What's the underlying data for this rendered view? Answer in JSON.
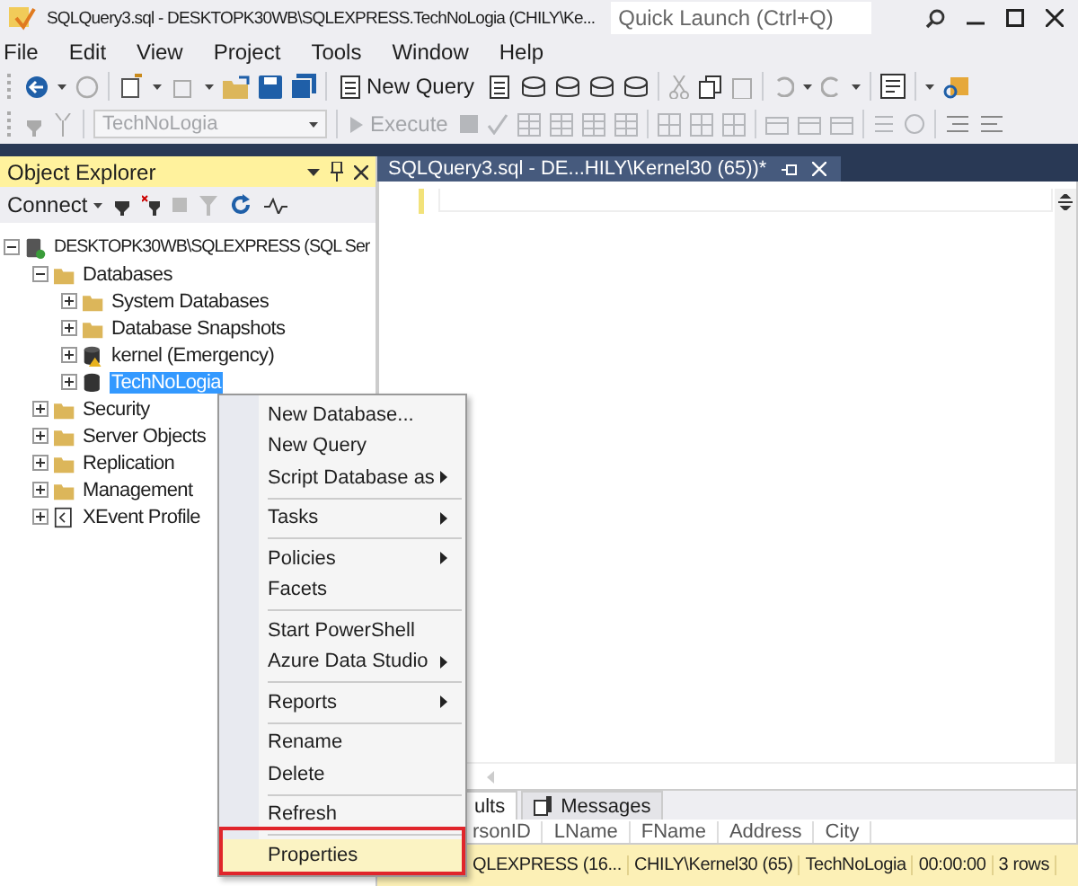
{
  "window": {
    "title": "SQLQuery3.sql - DESKTOPK30WB\\SQLEXPRESS.TechNoLogia (CHILY\\Ke...",
    "quick_launch": {
      "placeholder": "Quick Launch (Ctrl+Q)"
    }
  },
  "menu": [
    "File",
    "Edit",
    "View",
    "Project",
    "Tools",
    "Window",
    "Help"
  ],
  "toolbar": {
    "new_query": "New Query",
    "database": {
      "value": "TechNoLogia",
      "disabled": true
    },
    "execute": {
      "label": "Execute",
      "disabled": true
    }
  },
  "object_explorer": {
    "title": "Object Explorer",
    "active": true,
    "connect": "Connect",
    "tree": [
      {
        "label": "DESKTOPK30WB\\SQLEXPRESS (SQL Ser",
        "kind": "server",
        "expanded": true,
        "selected": false,
        "children": [
          {
            "label": "Databases",
            "kind": "folder",
            "expanded": true,
            "selected": false,
            "children": [
              {
                "label": "System Databases",
                "kind": "folder",
                "expanded": false,
                "selected": false
              },
              {
                "label": "Database Snapshots",
                "kind": "folder",
                "expanded": false,
                "selected": false
              },
              {
                "label": "kernel (Emergency)",
                "kind": "database-warning",
                "expanded": false,
                "selected": false
              },
              {
                "label": "TechNoLogia",
                "kind": "database",
                "expanded": false,
                "selected": true
              }
            ]
          },
          {
            "label": "Security",
            "kind": "folder",
            "expanded": false,
            "selected": false
          },
          {
            "label": "Server Objects",
            "kind": "folder",
            "expanded": false,
            "selected": false
          },
          {
            "label": "Replication",
            "kind": "folder",
            "expanded": false,
            "selected": false
          },
          {
            "label": "Management",
            "kind": "folder",
            "expanded": false,
            "selected": false
          },
          {
            "label": "XEvent Profile",
            "kind": "profiler",
            "expanded": false,
            "selected": false
          }
        ]
      }
    ]
  },
  "editor": {
    "tab": "SQLQuery3.sql - DE...HILY\\Kernel30 (65))*"
  },
  "results": {
    "tabs": [
      {
        "label": "ults",
        "selected": true
      },
      {
        "label": "Messages",
        "selected": false
      }
    ],
    "columns": [
      "rsonID",
      "LName",
      "FName",
      "Address",
      "City"
    ]
  },
  "status_bar": [
    "QLEXPRESS (16...",
    "CHILY\\Kernel30 (65)",
    "TechNoLogia",
    "00:00:00",
    "3 rows"
  ],
  "context_menu": {
    "items": [
      {
        "label": "New Database...",
        "submenu": false,
        "separator_before": false,
        "selected": false,
        "annotated": false
      },
      {
        "label": "New Query",
        "submenu": false,
        "separator_before": false,
        "selected": false,
        "annotated": false
      },
      {
        "label": "Script Database as",
        "submenu": true,
        "separator_before": false,
        "selected": false,
        "annotated": false
      },
      {
        "label": "Tasks",
        "submenu": true,
        "separator_before": true,
        "selected": false,
        "annotated": false
      },
      {
        "label": "Policies",
        "submenu": true,
        "separator_before": true,
        "selected": false,
        "annotated": false
      },
      {
        "label": "Facets",
        "submenu": false,
        "separator_before": false,
        "selected": false,
        "annotated": false
      },
      {
        "label": "Start PowerShell",
        "submenu": false,
        "separator_before": true,
        "selected": false,
        "annotated": false
      },
      {
        "label": "Azure Data Studio",
        "submenu": true,
        "separator_before": false,
        "selected": false,
        "annotated": false
      },
      {
        "label": "Reports",
        "submenu": true,
        "separator_before": true,
        "selected": false,
        "annotated": false
      },
      {
        "label": "Rename",
        "submenu": false,
        "separator_before": true,
        "selected": false,
        "annotated": false
      },
      {
        "label": "Delete",
        "submenu": false,
        "separator_before": false,
        "selected": false,
        "annotated": false
      },
      {
        "label": "Refresh",
        "submenu": false,
        "separator_before": true,
        "selected": false,
        "annotated": false
      },
      {
        "label": "Properties",
        "submenu": false,
        "separator_before": true,
        "selected": true,
        "annotated": true
      }
    ]
  }
}
